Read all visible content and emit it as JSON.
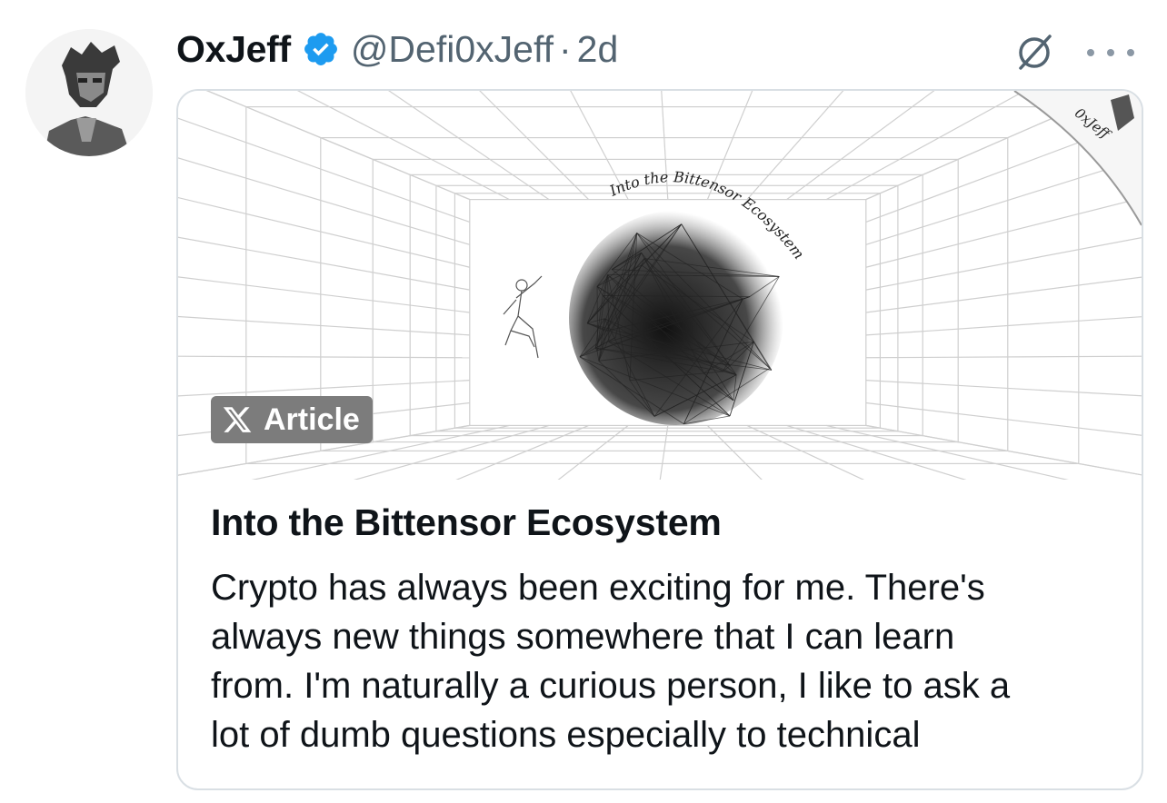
{
  "tweet": {
    "display_name": "OxJeff",
    "handle": "@Defi0xJeff",
    "separator": "·",
    "age": "2d",
    "icons": {
      "avatar": "avatar",
      "verified": "verified-badge-icon",
      "grok": "grok-icon",
      "more": "more-options-icon"
    },
    "colors": {
      "verified": "#1d9bf0",
      "secondary_text": "#536471"
    }
  },
  "article": {
    "badge_label": "Article",
    "badge_icon": "x-logo-icon",
    "cover_title_art": "Into the Bittensor Ecosystem",
    "cover_corner_label": "0xJeff",
    "title": "Into the Bittensor Ecosystem",
    "excerpt_lines": [
      "Crypto has always been exciting for me. There's",
      "always new things somewhere that I can learn",
      "from. I'm naturally a curious person, I like to ask a",
      "lot of dumb questions especially to technical"
    ]
  }
}
